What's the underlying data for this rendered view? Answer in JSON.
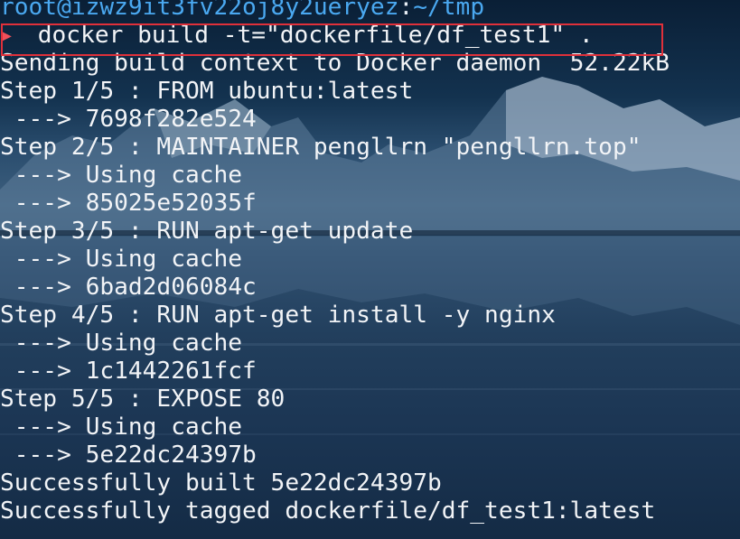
{
  "prompt": {
    "user_host": "root@izwz9it3fv22oj8y2ueryez",
    "separator": ":",
    "path": "~/tmp"
  },
  "command": {
    "arrow": "▶",
    "text": " docker build -t=\"dockerfile/df_test1\" ."
  },
  "output": [
    "Sending build context to Docker daemon  52.22kB",
    "Step 1/5 : FROM ubuntu:latest",
    " ---> 7698f282e524",
    "Step 2/5 : MAINTAINER pengllrn \"pengllrn.top\"",
    " ---> Using cache",
    " ---> 85025e52035f",
    "Step 3/5 : RUN apt-get update",
    " ---> Using cache",
    " ---> 6bad2d06084c",
    "Step 4/5 : RUN apt-get install -y nginx",
    " ---> Using cache",
    " ---> 1c1442261fcf",
    "Step 5/5 : EXPOSE 80",
    " ---> Using cache",
    " ---> 5e22dc24397b",
    "Successfully built 5e22dc24397b",
    "Successfully tagged dockerfile/df_test1:latest"
  ],
  "colors": {
    "prompt": "#4aa8f0",
    "text": "#f2f4f7",
    "highlight_border": "#e0303a",
    "arrow": "#f0505a"
  }
}
